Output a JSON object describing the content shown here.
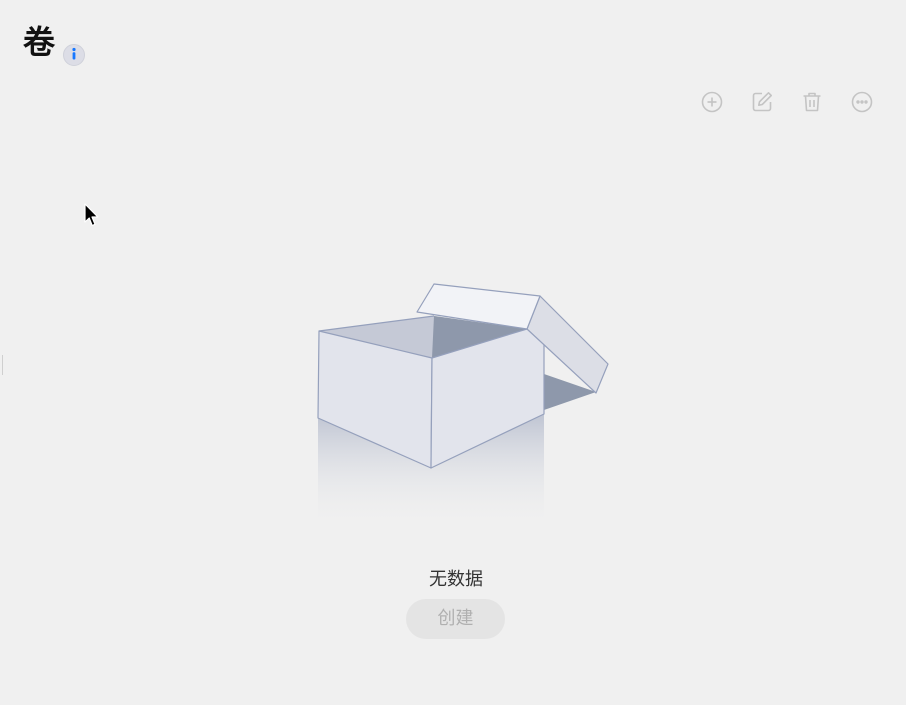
{
  "header": {
    "title": "卷"
  },
  "toolbar": {
    "icons": [
      "add-circle-icon",
      "edit-icon",
      "delete-icon",
      "more-icon"
    ]
  },
  "empty_state": {
    "message": "无数据",
    "create_label": "创建"
  },
  "colors": {
    "info_accent": "#1677ff",
    "toolbar_icon": "#c4c4c4",
    "disabled_text": "#b0b0b0"
  }
}
